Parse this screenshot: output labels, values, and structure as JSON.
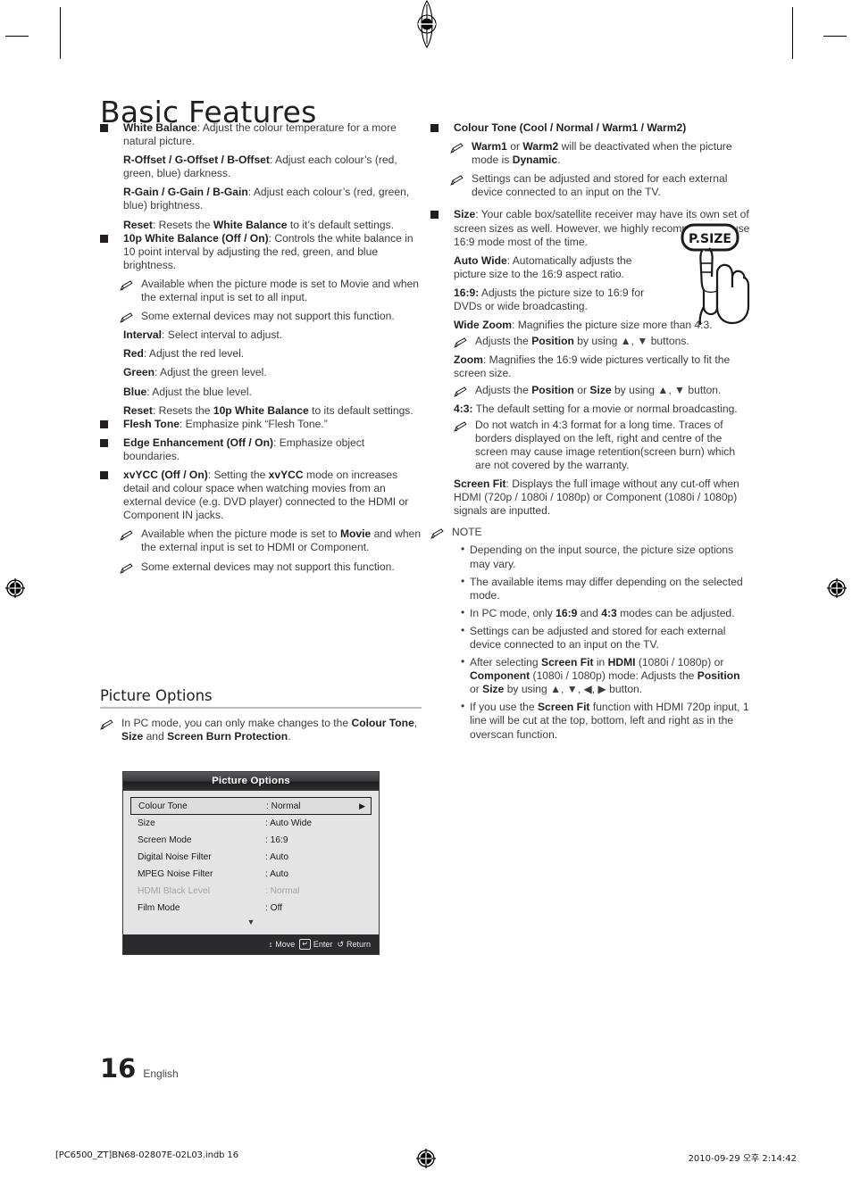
{
  "page": {
    "title": "Basic Features",
    "number": "16",
    "language": "English",
    "footer_left": "[PC6500_ZT]BN68-02807E-02L03.indb   16",
    "footer_right": "2010-09-29   오후 2:14:42"
  },
  "left_column": {
    "blocks": [
      {
        "kind": "bullet",
        "term": "White Balance",
        "text": ": Adjust the colour temperature for a more natural picture."
      },
      {
        "kind": "plain",
        "term": "R-Offset / G-Offset / B-Offset",
        "text": ": Adjust each colour’s (red, green, blue) darkness."
      },
      {
        "kind": "plain",
        "term": "R-Gain / G-Gain / B-Gain",
        "text": ": Adjust each colour’s (red, green, blue) brightness."
      },
      {
        "kind": "plain",
        "term": "Reset",
        "text": ": Resets the ",
        "term2": "White Balance",
        "text2": " to it’s default settings."
      },
      {
        "kind": "bullet",
        "term": "10p White Balance (Off / On)",
        "text": ": Controls the white balance in 10 point interval by adjusting the red, green, and blue brightness."
      },
      {
        "kind": "note",
        "text": "Available when the picture mode is set to Movie and when the external input is set to all input."
      },
      {
        "kind": "note",
        "text": "Some external devices may not support this function."
      },
      {
        "kind": "plain",
        "term": "Interval",
        "text": ": Select interval to adjust."
      },
      {
        "kind": "plain",
        "term": "Red",
        "text": ": Adjust the red level."
      },
      {
        "kind": "plain",
        "term": "Green",
        "text": ": Adjust the green level."
      },
      {
        "kind": "plain",
        "term": "Blue",
        "text": ": Adjust the blue level."
      },
      {
        "kind": "plain",
        "term": "Reset",
        "text": ": Resets the ",
        "term2": "10p White Balance",
        "text2": " to its default settings."
      },
      {
        "kind": "bullet",
        "term": "Flesh Tone",
        "text": ": Emphasize pink “Flesh Tone.”"
      },
      {
        "kind": "bullet",
        "term": "Edge Enhancement (Off / On)",
        "text": ": Emphasize object boundaries."
      },
      {
        "kind": "bullet",
        "term": "xvYCC (Off / On)",
        "text": ": Setting the ",
        "term2": "xvYCC",
        "text2": " mode on increases detail and colour space when watching movies from an external device (e.g. DVD player) connected to the HDMI or Component IN jacks."
      },
      {
        "kind": "note",
        "text_pre": "Available when the picture mode is set to ",
        "term": "Movie",
        "text_post": " and when the external input is set to HDMI or Component."
      },
      {
        "kind": "note",
        "text": "Some external devices may not support this function."
      }
    ]
  },
  "section": {
    "heading": "Picture Options",
    "note_pre": "In PC mode, you can only make changes to the ",
    "note_t1": "Colour Tone",
    "note_mid1": ", ",
    "note_t2": "Size",
    "note_mid2": " and ",
    "note_t3": "Screen Burn Protection",
    "note_post": "."
  },
  "osd": {
    "title": "Picture Options",
    "rows": [
      {
        "label": "Colour Tone",
        "value": ": Normal",
        "selected": true,
        "dimmed": false,
        "arrow": "▶"
      },
      {
        "label": "Size",
        "value": ": Auto Wide",
        "selected": false,
        "dimmed": false,
        "arrow": ""
      },
      {
        "label": "Screen Mode",
        "value": ": 16:9",
        "selected": false,
        "dimmed": false,
        "arrow": ""
      },
      {
        "label": "Digital Noise Filter",
        "value": ": Auto",
        "selected": false,
        "dimmed": false,
        "arrow": ""
      },
      {
        "label": "MPEG Noise Filter",
        "value": ": Auto",
        "selected": false,
        "dimmed": false,
        "arrow": ""
      },
      {
        "label": "HDMI Black Level",
        "value": ": Normal",
        "selected": false,
        "dimmed": true,
        "arrow": ""
      },
      {
        "label": "Film Mode",
        "value": ": Off",
        "selected": false,
        "dimmed": false,
        "arrow": ""
      }
    ],
    "scroll_glyph": "▼",
    "footer": {
      "move_glyph": "↕",
      "move_label": "Move",
      "enter_glyph": "↵",
      "enter_label": "Enter",
      "return_glyph": "↺",
      "return_label": "Return"
    }
  },
  "right_column": {
    "blocks": [
      {
        "kind": "bullet",
        "term": "Colour Tone (Cool / Normal / Warm1 / Warm2)",
        "text": ""
      },
      {
        "kind": "note",
        "term": "Warm1",
        "mid": " or ",
        "term2": "Warm2",
        "text": " will be deactivated when the picture mode is ",
        "term3": "Dynamic",
        "text2": "."
      },
      {
        "kind": "note",
        "text": "Settings can be adjusted and stored for each external device connected to an input on the TV."
      },
      {
        "kind": "bullet",
        "term": "Size",
        "text": ": Your cable box/satellite receiver may have its own set of screen sizes as well. However, we highly recommend you use 16:9 mode most of the time."
      },
      {
        "kind": "plain",
        "term": "Auto Wide",
        "text": ": Automatically adjusts the picture size to the 16:9 aspect ratio."
      },
      {
        "kind": "plain",
        "term": "16:9:",
        "text": " Adjusts the picture size to 16:9 for DVDs or wide broadcasting."
      },
      {
        "kind": "plain",
        "term": "Wide Zoom",
        "text": ": Magnifies the picture size more than 4:3."
      },
      {
        "kind": "note",
        "text_pre": "Adjusts the ",
        "term": "Position",
        "text_post": " by using ▲, ▼ buttons."
      },
      {
        "kind": "plain",
        "term": "Zoom",
        "text": ": Magnifies the 16:9 wide pictures vertically to fit the screen size."
      },
      {
        "kind": "note",
        "text_pre": "Adjusts the ",
        "term": "Position",
        "mid": " or ",
        "term2": "Size",
        "text_post": " by using ▲, ▼ button."
      },
      {
        "kind": "plain",
        "term": "4:3:",
        "text": " The default setting for a movie or normal broadcasting."
      },
      {
        "kind": "note",
        "text": "Do not watch in 4:3 format for a long time. Traces of borders displayed on the left, right and centre of the screen may cause image retention(screen burn) which are not covered by the warranty."
      },
      {
        "kind": "plain",
        "term": "Screen Fit",
        "text": ": Displays the full image without any cut-off when HDMI (720p / 1080i / 1080p) or Component (1080i / 1080p) signals are inputted."
      }
    ],
    "note_heading": "NOTE",
    "note_items": [
      {
        "text": "Depending on the input source, the picture size options may vary."
      },
      {
        "text": "The available items may differ depending on the selected mode."
      },
      {
        "text_pre": "In PC mode, only ",
        "term": "16:9",
        "mid": " and ",
        "term2": "4:3",
        "text_post": " modes can be adjusted."
      },
      {
        "text": "Settings can be adjusted and stored for each external device connected to an input on the TV."
      },
      {
        "text_pre": "After selecting ",
        "term": "Screen Fit",
        "mid": " in ",
        "term2": "HDMI",
        "mid2": " (1080i / 1080p) or ",
        "term3": "Component",
        "mid3": " (1080i / 1080p) mode: Adjusts the ",
        "term4": "Position",
        "mid4": " or ",
        "term5": "Size",
        "text_post": " by using ▲, ▼, ◀, ▶ button."
      },
      {
        "text_pre": "If you use the ",
        "term": "Screen Fit",
        "text_post": " function with HDMI 720p input, 1 line will be cut at the top, bottom, left and right as in the overscan function."
      }
    ]
  },
  "illustration": {
    "button_label": "P.SIZE"
  }
}
